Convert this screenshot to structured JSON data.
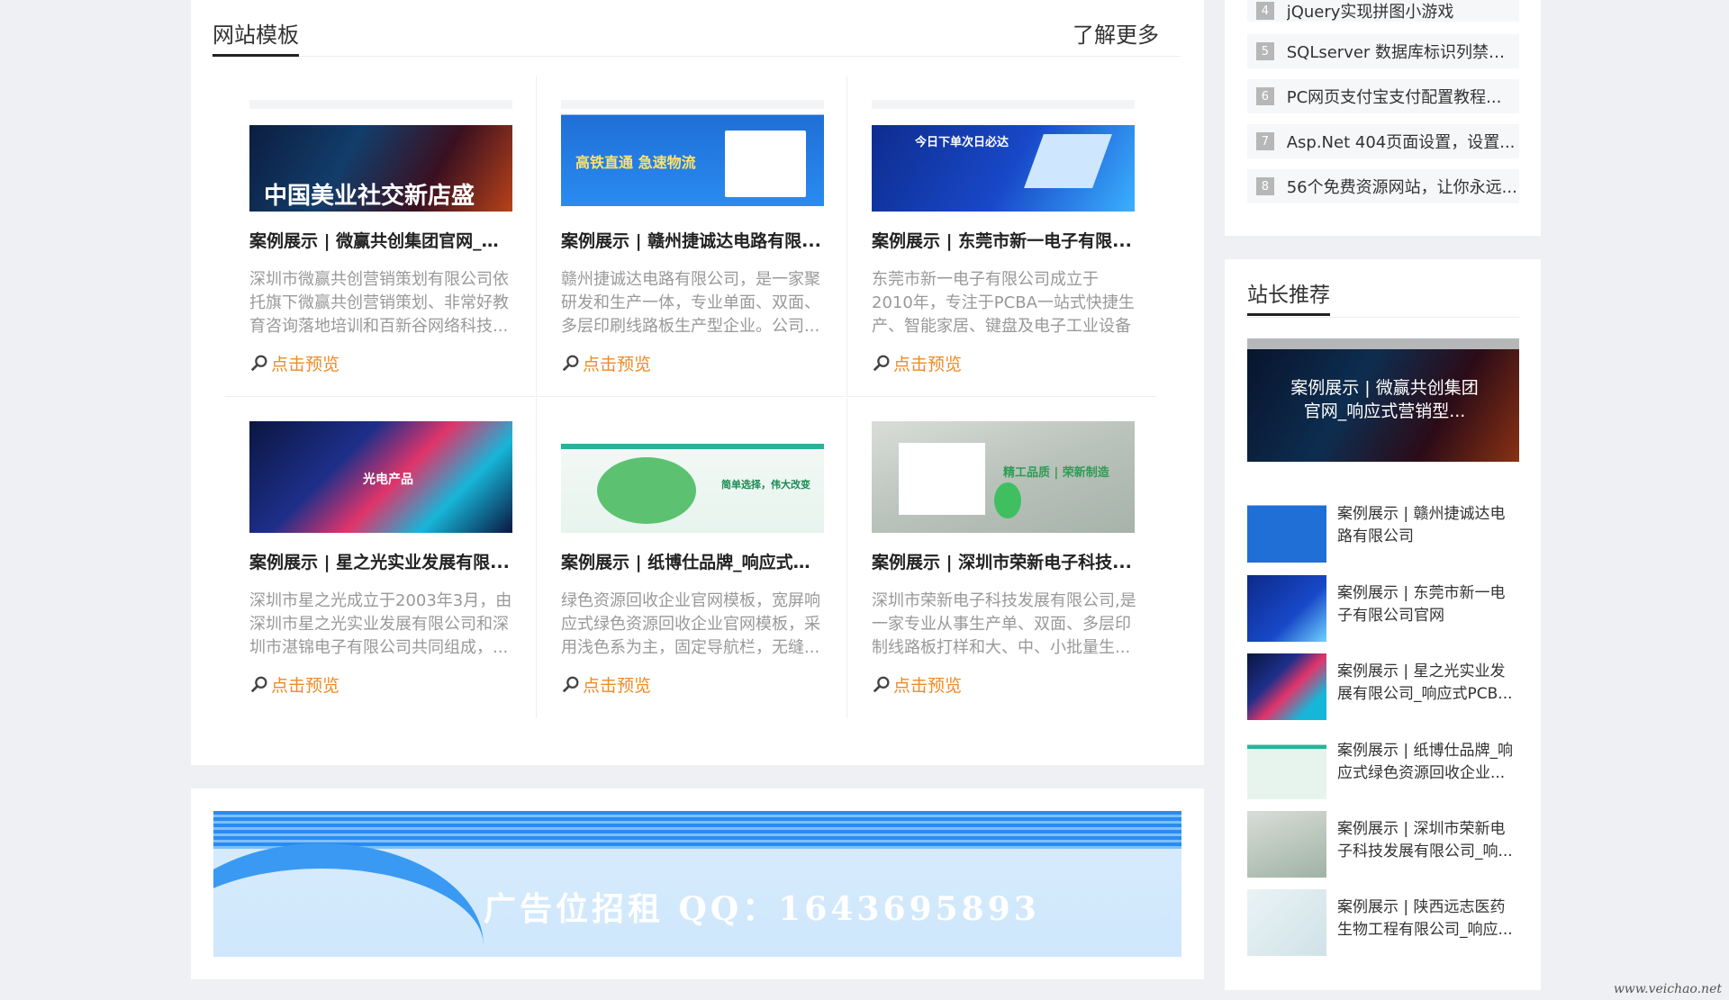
{
  "templates": {
    "title": "网站模板",
    "more_label": "了解更多",
    "preview_label": "点击预览",
    "cards": [
      {
        "title": "案例展示 | 微赢共创集团官网_响...",
        "desc": "深圳市微赢共创营销策划有限公司依托旗下微赢共创营销策划、非常好教育咨询落地培训和百新谷网络科技...",
        "banner": "中国美业社交新店盛",
        "theme": "dark-fire"
      },
      {
        "title": "案例展示 | 赣州捷诚达电路有限...",
        "desc": "赣州捷诚达电路有限公司，是一家聚研发和生产一体，专业单面、双面、多层印刷线路板生产型企业。公司...",
        "banner": "高铁直通 急速物流",
        "theme": "blue"
      },
      {
        "title": "案例展示 | 东莞市新一电子有限...",
        "desc": "东莞市新一电子有限公司成立于2010年，专注于PCBA一站式快捷生产、智能家居、键盘及电子工业设备控制...",
        "banner": "今日下单次日必达",
        "theme": "navy-chip"
      },
      {
        "title": "案例展示 | 星之光实业发展有限...",
        "desc": "深圳市星之光成立于2003年3月，由深圳市星之光实业发展有限公司和深圳市湛锦电子有限公司共同组成，...",
        "banner": "光电产品",
        "theme": "neon"
      },
      {
        "title": "案例展示 | 纸博仕品牌_响应式绿...",
        "desc": "绿色资源回收企业官网模板，宽屏响应式绿色资源回收企业官网模板，采用浅色系为主，固定导航栏，无缝...",
        "banner": "简单选择，伟大改变",
        "theme": "green"
      },
      {
        "title": "案例展示 | 深圳市荣新电子科技...",
        "desc": "深圳市荣新电子科技发展有限公司,是一家专业从事生产单、双面、多层印制线路板打样和大、中、小批量生...",
        "banner": "精工品质 | 荣新制造",
        "theme": "grey-green"
      }
    ]
  },
  "ad": {
    "text": "广告位招租    QQ：1643695893"
  },
  "rank": {
    "items": [
      {
        "num": "4",
        "text": "jQuery实现拼图小游戏"
      },
      {
        "num": "5",
        "text": "SQLserver 数据库标识列禁用..."
      },
      {
        "num": "6",
        "text": "PC网页支付宝支付配置教程..."
      },
      {
        "num": "7",
        "text": "Asp.Net 404页面设置，设置..."
      },
      {
        "num": "8",
        "text": "56个免费资源网站，让你永远..."
      }
    ]
  },
  "recommend": {
    "title": "站长推荐",
    "feature_title": "案例展示 | 微赢共创集团官网_响应式营销型...",
    "items": [
      {
        "text": "案例展示 | 赣州捷诚达电路有限公司",
        "theme": "blue"
      },
      {
        "text": "案例展示 | 东莞市新一电子有限公司官网",
        "theme": "navy-chip"
      },
      {
        "text": "案例展示 | 星之光实业发展有限公司_响应式PCB...",
        "theme": "neon"
      },
      {
        "text": "案例展示 | 纸博仕品牌_响应式绿色资源回收企业...",
        "theme": "green"
      },
      {
        "text": "案例展示 | 深圳市荣新电子科技发展有限公司_响...",
        "theme": "grey-green"
      },
      {
        "text": "案例展示 | 陕西远志医药生物工程有限公司_响应...",
        "theme": "pale"
      }
    ]
  },
  "watermark": "www.veichao.net",
  "colors": {
    "accent_orange": "#f08a24",
    "rank_badge": "#b7b7b7",
    "title_text": "#222222",
    "desc_text": "#999999"
  }
}
